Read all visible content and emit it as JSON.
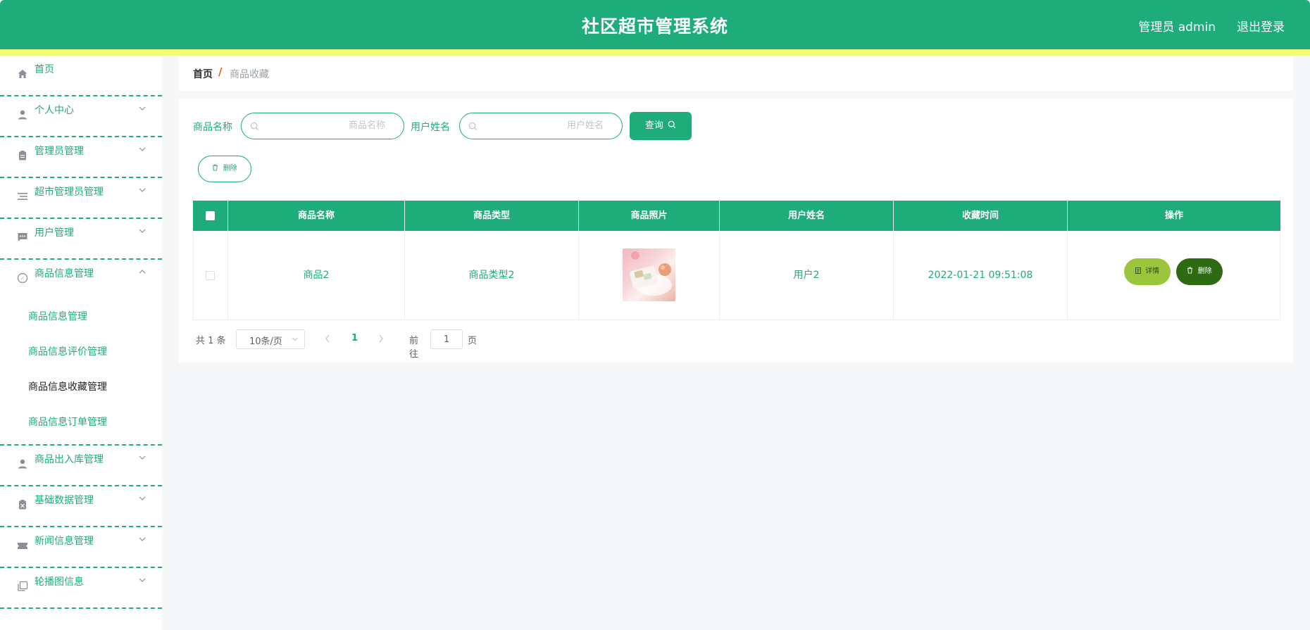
{
  "header": {
    "title": "社区超市管理系统",
    "user": "管理员 admin",
    "logout": "退出登录"
  },
  "sidebar": {
    "items": [
      {
        "label": "首页",
        "icon": "home-icon"
      },
      {
        "label": "个人中心",
        "icon": "user-icon"
      },
      {
        "label": "管理员管理",
        "icon": "clipboard-icon"
      },
      {
        "label": "超市管理员管理",
        "icon": "list-icon"
      },
      {
        "label": "用户管理",
        "icon": "chat-icon"
      },
      {
        "label": "商品信息管理",
        "icon": "compass-icon"
      },
      {
        "label": "商品出入库管理",
        "icon": "user-icon"
      },
      {
        "label": "基础数据管理",
        "icon": "clipboard-icon"
      },
      {
        "label": "新闻信息管理",
        "icon": "ticket-icon"
      },
      {
        "label": "轮播图信息",
        "icon": "copy-icon"
      }
    ],
    "submenu": [
      "商品信息管理",
      "商品信息评价管理",
      "商品信息收藏管理",
      "商品信息订单管理"
    ]
  },
  "breadcrumb": {
    "home": "首页",
    "separator": "/",
    "current": "商品收藏"
  },
  "search": {
    "name_label": "商品名称",
    "name_placeholder": "商品名称",
    "user_label": "用户姓名",
    "user_placeholder": "用户姓名",
    "query_label": "查询"
  },
  "toolbar": {
    "delete_label": "删除"
  },
  "table": {
    "headers": [
      "商品名称",
      "商品类型",
      "商品照片",
      "用户姓名",
      "收藏时间",
      "操作"
    ],
    "rows": [
      {
        "name": "商品2",
        "type": "商品类型2",
        "user": "用户2",
        "time": "2022-01-21 09:51:08",
        "detail": "详情",
        "delete": "删除"
      }
    ]
  },
  "pagination": {
    "total": "共 1 条",
    "page_size": "10条/页",
    "current": "1",
    "goto": "前往",
    "jump_value": "1",
    "page_suffix": "页"
  },
  "colors": {
    "primary": "#1dac7a",
    "accent_line": "#f3ff73",
    "detail_button": "#9bc63c",
    "delete_button": "#2d6a12"
  }
}
